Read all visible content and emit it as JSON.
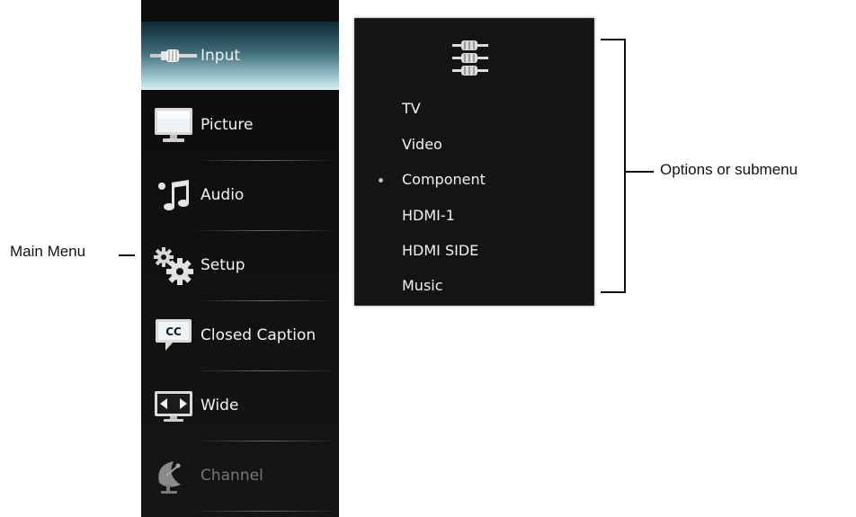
{
  "main_menu": {
    "items": [
      {
        "label": "Input",
        "icon": "rca-cable-icon",
        "state": "selected"
      },
      {
        "label": "Picture",
        "icon": "monitor-icon",
        "state": "normal"
      },
      {
        "label": "Audio",
        "icon": "music-note-icon",
        "state": "normal"
      },
      {
        "label": "Setup",
        "icon": "gears-icon",
        "state": "normal"
      },
      {
        "label": "Closed Caption",
        "icon": "closed-caption-icon",
        "state": "normal"
      },
      {
        "label": "Wide",
        "icon": "wide-screen-icon",
        "state": "normal"
      },
      {
        "label": "Channel",
        "icon": "satellite-dish-icon",
        "state": "disabled"
      }
    ]
  },
  "submenu": {
    "icon": "component-cables-icon",
    "options": [
      {
        "label": "TV",
        "selected": false
      },
      {
        "label": "Video",
        "selected": false
      },
      {
        "label": "Component",
        "selected": true
      },
      {
        "label": "HDMI-1",
        "selected": false
      },
      {
        "label": "HDMI SIDE",
        "selected": false
      },
      {
        "label": "Music",
        "selected": false
      }
    ]
  },
  "annotations": {
    "main_menu": "Main Menu",
    "submenu": "Options or submenu"
  },
  "colors": {
    "menu_background": "#111111",
    "selected_highlight": "#a9cfd7",
    "disabled_text": "#777777",
    "annotation_text": "#111111"
  }
}
